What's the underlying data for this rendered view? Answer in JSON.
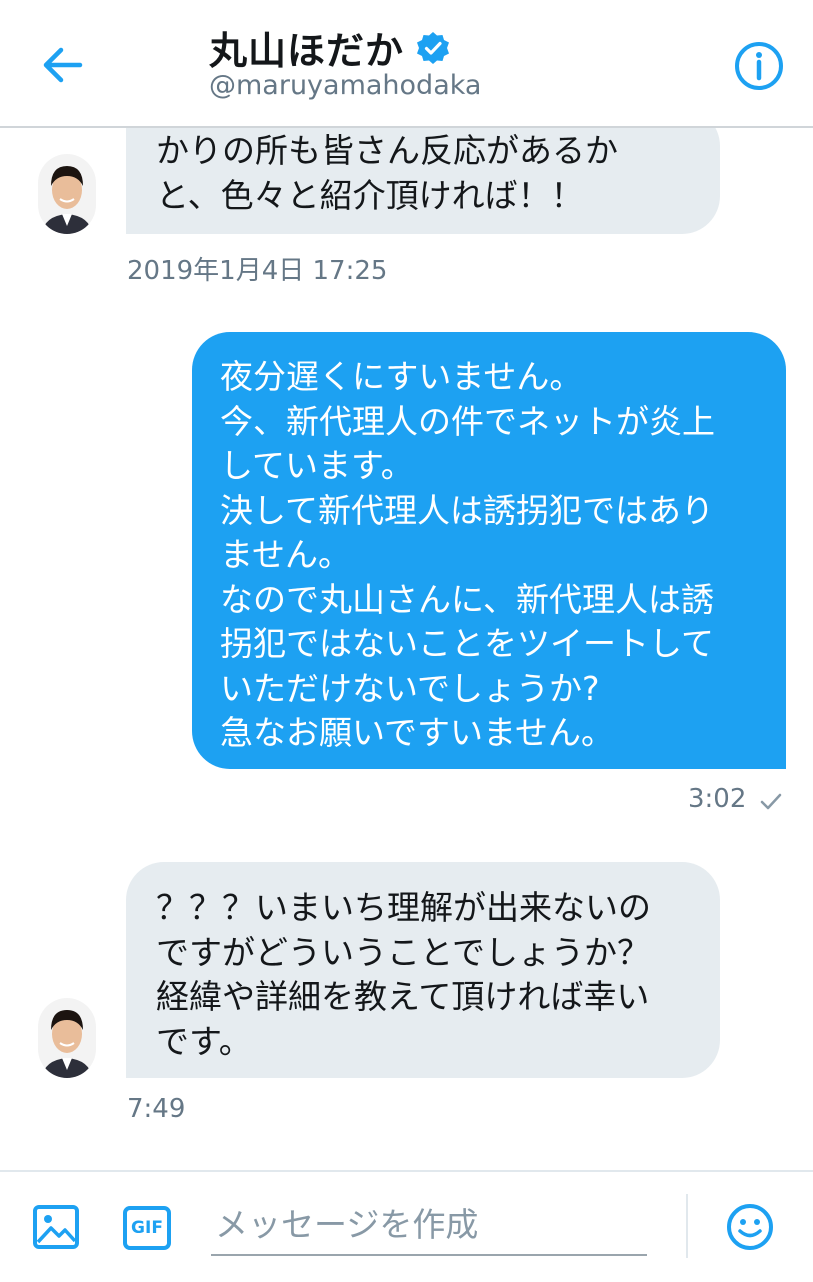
{
  "header": {
    "name": "丸山ほだか",
    "handle": "@maruyamahodaka",
    "icons": {
      "back": "back-arrow-icon",
      "verified": "verified-badge-icon",
      "info": "info-icon"
    }
  },
  "messages": [
    {
      "from": "them",
      "text": "かりの所も皆さん反応があるか\nと、色々と紹介頂ければ！！",
      "timestamp": "2019年1月4日 17:25"
    },
    {
      "from": "me",
      "text": "夜分遅くにすいません。\n今、新代理人の件でネットが炎上\nしています。\n決して新代理人は誘拐犯ではあり\nません。\nなので丸山さんに、新代理人は誘\n拐犯ではないことをツイートして\nいただけないでしょうか?\n急なお願いですいません。",
      "timestamp": "3:02"
    },
    {
      "from": "them",
      "text": "？？？いまいち理解が出来ないの\nですがどういうことでしょうか？\n経緯や詳細を教えて頂ければ幸い\nです。",
      "timestamp": "7:49"
    }
  ],
  "compose": {
    "placeholder": "メッセージを作成",
    "gif_label": "GIF",
    "icons": {
      "image": "image-icon",
      "gif": "gif-icon",
      "emoji": "emoji-icon"
    }
  },
  "colors": {
    "accent": "#1da1f2",
    "incoming_bubble": "#e6ecf0",
    "secondary_text": "#657786"
  }
}
